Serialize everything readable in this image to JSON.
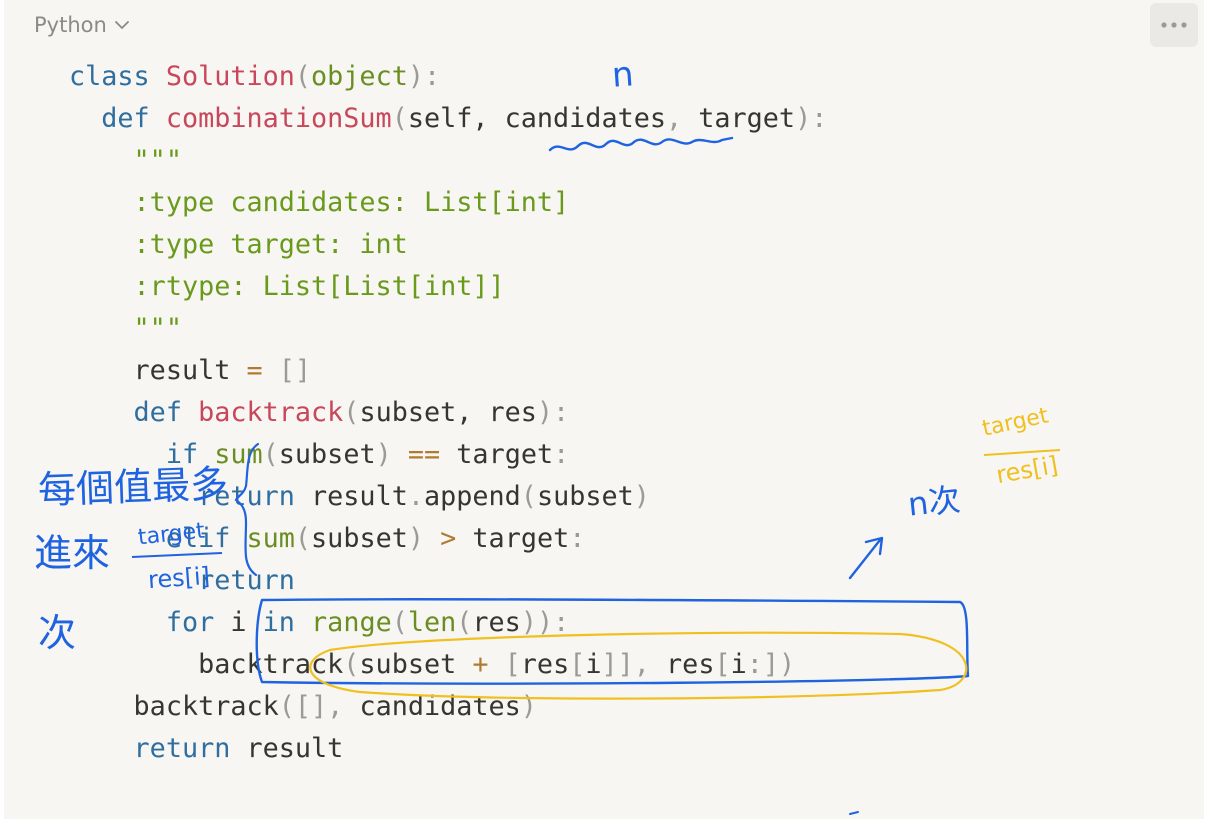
{
  "header": {
    "language": "Python"
  },
  "code_lines": [
    [
      "class",
      " ",
      "Solution",
      "(",
      "object",
      "):"
    ],
    [
      "def",
      " ",
      "combinationSum",
      "(",
      "self, candidates",
      ",",
      " target",
      "):"
    ],
    [
      "\"\"\""
    ],
    [
      ":type candidates: List[int]"
    ],
    [
      ":type target: int"
    ],
    [
      ":rtype: List[List[int]]"
    ],
    [
      "\"\"\""
    ],
    [
      "result",
      " ",
      "=",
      " ",
      "[]"
    ],
    [
      "def",
      " ",
      "backtrack",
      "(",
      "subset, res",
      "):"
    ],
    [
      "if",
      " ",
      "sum",
      "(",
      "subset",
      ")",
      " ",
      "==",
      " ",
      "target",
      ":"
    ],
    [
      "return",
      " ",
      "result",
      ".",
      "append",
      "(",
      "subset",
      ")"
    ],
    [
      "elif",
      " ",
      "sum",
      "(",
      "subset",
      ")",
      " ",
      ">",
      " ",
      "target",
      ":"
    ],
    [
      "return"
    ],
    [
      "for",
      " i ",
      "in",
      " ",
      "range",
      "(",
      "len",
      "(",
      "res",
      "))",
      ":"
    ],
    [
      "backtrack",
      "(",
      "subset",
      " ",
      "+",
      " ",
      "[",
      "res",
      "[",
      "i",
      "]]",
      ", ",
      "res",
      "[",
      "i",
      ":",
      "])"
    ],
    [
      "backtrack",
      "([]",
      ", ",
      "candidates",
      ")"
    ],
    [
      "return",
      " ",
      "result"
    ]
  ],
  "annotations": {
    "n_mark": "n",
    "target_res_right_top": "target",
    "target_res_right_bottom": "res[i]",
    "n_times": "n次",
    "left_line1": "每個值最多",
    "left_line2": "進來",
    "left_frac_top": "target",
    "left_frac_bottom": "res[i]",
    "left_line3": "次"
  },
  "colors": {
    "keyword": "#2f6e9f",
    "function": "#c8475b",
    "builtin": "#6b8e23",
    "docstring": "#6a9a1c",
    "text": "#37352f",
    "ink_blue": "#1f63e0",
    "ink_yellow": "#f0c020"
  },
  "icons": {
    "language_dropdown": "chevron-down-icon",
    "more": "more-horizontal-icon"
  }
}
